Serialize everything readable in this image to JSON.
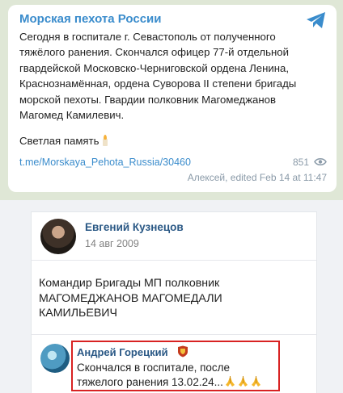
{
  "telegram": {
    "channel_name": "Морская пехота России",
    "message_lines": [
      "Сегодня в госпитале г. Севастополь от полученного",
      "тяжёлого ранения. Скончался офицер 77-й отдельной",
      "гвардейской Московско-Черниговской ордена Ленина,",
      "Краснознамённая, ордена Суворова II степени бригады",
      "морской пехоты. Гвардии полковник Магомеджанов",
      "Магомед Камилевич."
    ],
    "memory_text": "Светлая память",
    "link": "t.me/Morskaya_Pehota_Russia/30460",
    "views": "851",
    "meta": "Алексей, edited  Feb 14 at 11:47",
    "icons": {
      "logo": "telegram-plane-icon",
      "views": "eye-icon",
      "emoji": "candle-icon"
    },
    "colors": {
      "background": "#dfe7d6",
      "accent": "#3a8ccc"
    }
  },
  "vk": {
    "post_author": "Евгений Кузнецов",
    "post_date": "14 авг 2009",
    "post_lines": [
      "Командир Бригады МП полковник",
      "МАГОМЕДЖАНОВ МАГОМЕДАЛИ",
      "КАМИЛЬЕВИЧ"
    ],
    "comment": {
      "author": "Андрей Горецкий",
      "line1": "Скончался в госпитале, после",
      "line2": "тяжелого ранения 13.02.24...",
      "icons": {
        "badge": "emblem-icon",
        "emoji": "praying-hands-icon"
      }
    },
    "colors": {
      "name": "#2a5885",
      "highlight_border": "#d82222"
    }
  }
}
